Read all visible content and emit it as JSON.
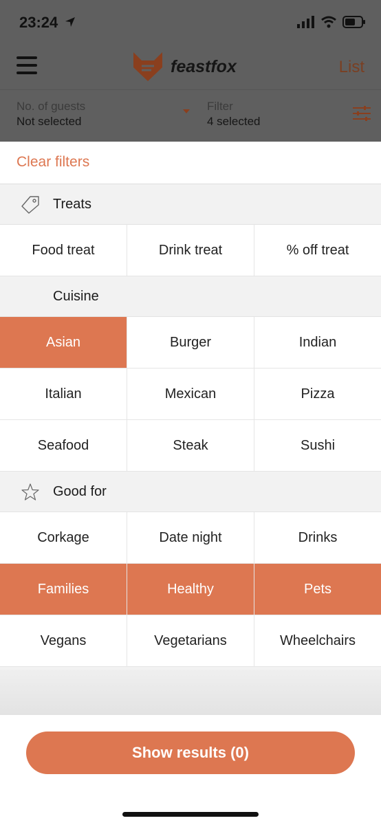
{
  "status_bar": {
    "time": "23:24"
  },
  "header": {
    "logo_text": "feastfox",
    "list_label": "List"
  },
  "filter_bar": {
    "guests_caption": "No. of guests",
    "guests_value": "Not selected",
    "filter_caption": "Filter",
    "filter_value": "4 selected"
  },
  "panel": {
    "clear_filters": "Clear filters",
    "sections": [
      {
        "title": "Treats",
        "icon": "tag-icon",
        "options": [
          {
            "label": "Food treat",
            "selected": false
          },
          {
            "label": "Drink treat",
            "selected": false
          },
          {
            "label": "% off treat",
            "selected": false
          }
        ]
      },
      {
        "title": "Cuisine",
        "icon": "",
        "options": [
          {
            "label": "Asian",
            "selected": true
          },
          {
            "label": "Burger",
            "selected": false
          },
          {
            "label": "Indian",
            "selected": false
          },
          {
            "label": "Italian",
            "selected": false
          },
          {
            "label": "Mexican",
            "selected": false
          },
          {
            "label": "Pizza",
            "selected": false
          },
          {
            "label": "Seafood",
            "selected": false
          },
          {
            "label": "Steak",
            "selected": false
          },
          {
            "label": "Sushi",
            "selected": false
          }
        ]
      },
      {
        "title": "Good for",
        "icon": "star-icon",
        "options": [
          {
            "label": "Corkage",
            "selected": false
          },
          {
            "label": "Date night",
            "selected": false
          },
          {
            "label": "Drinks",
            "selected": false
          },
          {
            "label": "Families",
            "selected": true
          },
          {
            "label": "Healthy",
            "selected": true
          },
          {
            "label": "Pets",
            "selected": true
          },
          {
            "label": "Vegans",
            "selected": false
          },
          {
            "label": "Vegetarians",
            "selected": false
          },
          {
            "label": "Wheelchairs",
            "selected": false
          }
        ]
      }
    ]
  },
  "footer": {
    "show_results": "Show results (0)"
  },
  "colors": {
    "accent": "#dd7751",
    "dim_overlay": "#5f5f5f",
    "section_bg": "#f2f2f2"
  }
}
